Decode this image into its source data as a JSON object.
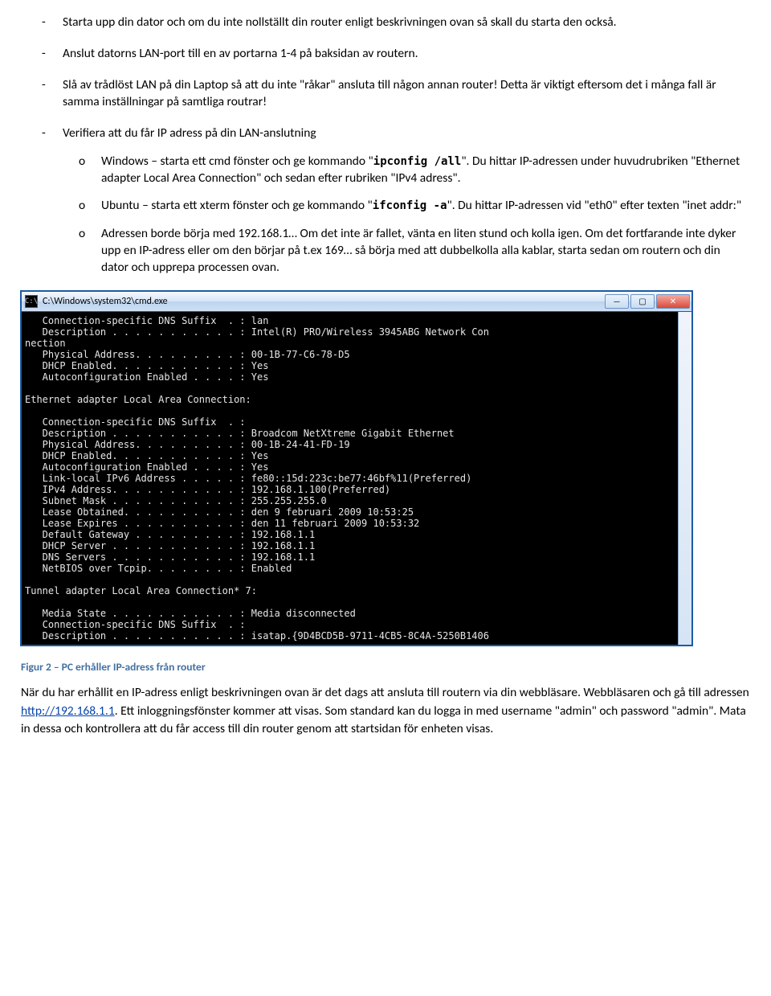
{
  "bullets": {
    "b1": "Starta upp din dator och om du inte nollställt din router enligt beskrivningen ovan så skall du starta den också.",
    "b2": "Anslut datorns LAN-port till en av portarna 1-4 på baksidan av routern.",
    "b3": "Slå av trådlöst LAN på din Laptop så att du inte \"råkar\" ansluta till någon annan router! Detta är viktigt eftersom det i många fall är samma inställningar på samtliga routrar!",
    "b4": "Verifiera att du får IP adress på din LAN-anslutning",
    "s1a": "Windows – starta ett cmd fönster och ge kommando \"",
    "s1cmd": "ipconfig /all",
    "s1b": "\". Du hittar IP-adressen under huvudrubriken \"Ethernet adapter Local Area Connection\" och sedan efter rubriken \"IPv4 adress\".",
    "s2a": "Ubuntu – starta ett xterm fönster och ge kommando \"",
    "s2cmd": "ifconfig -a",
    "s2b": "\". Du hittar IP-adressen vid \"eth0\" efter texten \"inet addr:\"",
    "s3": "Adressen borde börja med 192.168.1… Om det inte är fallet, vänta en liten stund och kolla igen. Om det fortfarande inte dyker upp en IP-adress eller om den börjar på t.ex 169… så börja med att dubbelkolla alla kablar, starta sedan om routern och din dator och upprepa processen ovan."
  },
  "cmd": {
    "title": "C:\\Windows\\system32\\cmd.exe",
    "icon_glyph": "C:\\",
    "output": "   Connection-specific DNS Suffix  . : lan\n   Description . . . . . . . . . . . : Intel(R) PRO/Wireless 3945ABG Network Con\nnection\n   Physical Address. . . . . . . . . : 00-1B-77-C6-78-D5\n   DHCP Enabled. . . . . . . . . . . : Yes\n   Autoconfiguration Enabled . . . . : Yes\n\nEthernet adapter Local Area Connection:\n\n   Connection-specific DNS Suffix  . :\n   Description . . . . . . . . . . . : Broadcom NetXtreme Gigabit Ethernet\n   Physical Address. . . . . . . . . : 00-1B-24-41-FD-19\n   DHCP Enabled. . . . . . . . . . . : Yes\n   Autoconfiguration Enabled . . . . : Yes\n   Link-local IPv6 Address . . . . . : fe80::15d:223c:be77:46bf%11(Preferred)\n   IPv4 Address. . . . . . . . . . . : 192.168.1.100(Preferred)\n   Subnet Mask . . . . . . . . . . . : 255.255.255.0\n   Lease Obtained. . . . . . . . . . : den 9 februari 2009 10:53:25\n   Lease Expires . . . . . . . . . . : den 11 februari 2009 10:53:32\n   Default Gateway . . . . . . . . . : 192.168.1.1\n   DHCP Server . . . . . . . . . . . : 192.168.1.1\n   DNS Servers . . . . . . . . . . . : 192.168.1.1\n   NetBIOS over Tcpip. . . . . . . . : Enabled\n\nTunnel adapter Local Area Connection* 7:\n\n   Media State . . . . . . . . . . . : Media disconnected\n   Connection-specific DNS Suffix  . :\n   Description . . . . . . . . . . . : isatap.{9D4BCD5B-9711-4CB5-8C4A-5250B1406"
  },
  "caption": "Figur 2 – PC erhåller IP-adress från router",
  "after": {
    "p1a": "När du har erhållit en IP-adress enligt beskrivningen ovan är det dags att ansluta till routern via din webbläsare. Webbläsaren och gå till adressen ",
    "link": "http://192.168.1.1",
    "p1b": ". Ett inloggningsfönster kommer att visas. Som standard kan du logga in med username \"admin\" och password \"admin\". Mata in dessa och kontrollera att du får access till din router genom att startsidan för enheten visas."
  }
}
